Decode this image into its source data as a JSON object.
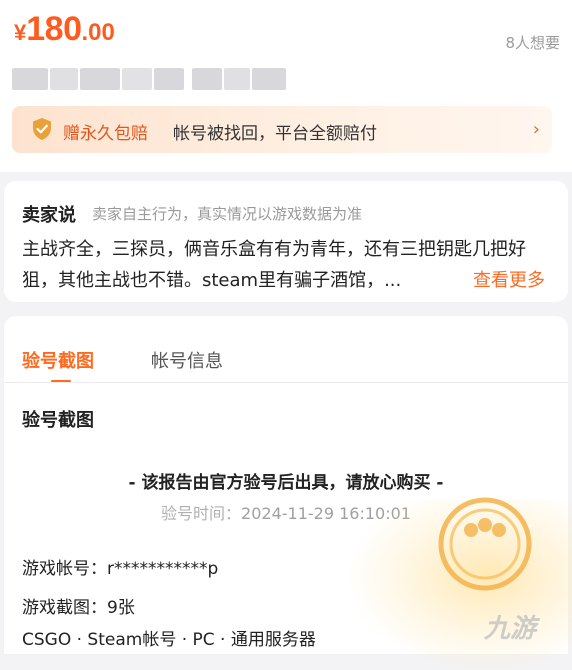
{
  "listing": {
    "currency_symbol": "¥",
    "price_integer": "180",
    "price_decimal": ".00",
    "wants_count": "8人想要",
    "guarantee_title": "赠永久包赔",
    "guarantee_desc": "帐号被找回，平台全额赔付",
    "guarantee_chevron": "›"
  },
  "seller": {
    "heading": "卖家说",
    "note": "卖家自主行为，真实情况以游戏数据为准",
    "text": "主战齐全，三探员，俩音乐盒有有为青年，还有三把钥匙几把好狙，其他主战也不错。steam里有骗子酒馆，...",
    "see_more": "查看更多"
  },
  "tabs": [
    {
      "label": "验号截图"
    },
    {
      "label": "帐号信息"
    }
  ],
  "report": {
    "section_title": "验号截图",
    "heading": "- 该报告由官方验号后出具，请放心购买 -",
    "time_label": "验号时间：",
    "time_value": "2024-11-29 16:10:01",
    "account_label": "游戏帐号：",
    "account_value": "r***********p",
    "screens_label": "游戏截图：",
    "screens_value": "9张",
    "game_info": "CSGO · Steam帐号 · PC · 通用服务器"
  },
  "watermark": "九游",
  "colors": {
    "accent": "#ff6a21",
    "price": "#ff5a1f",
    "guarantee_bg": "#fde3cf"
  },
  "icons": {
    "guarantee": "shield-check-icon",
    "chevron": "chevron-right-icon",
    "stamp": "official-seal-icon"
  }
}
